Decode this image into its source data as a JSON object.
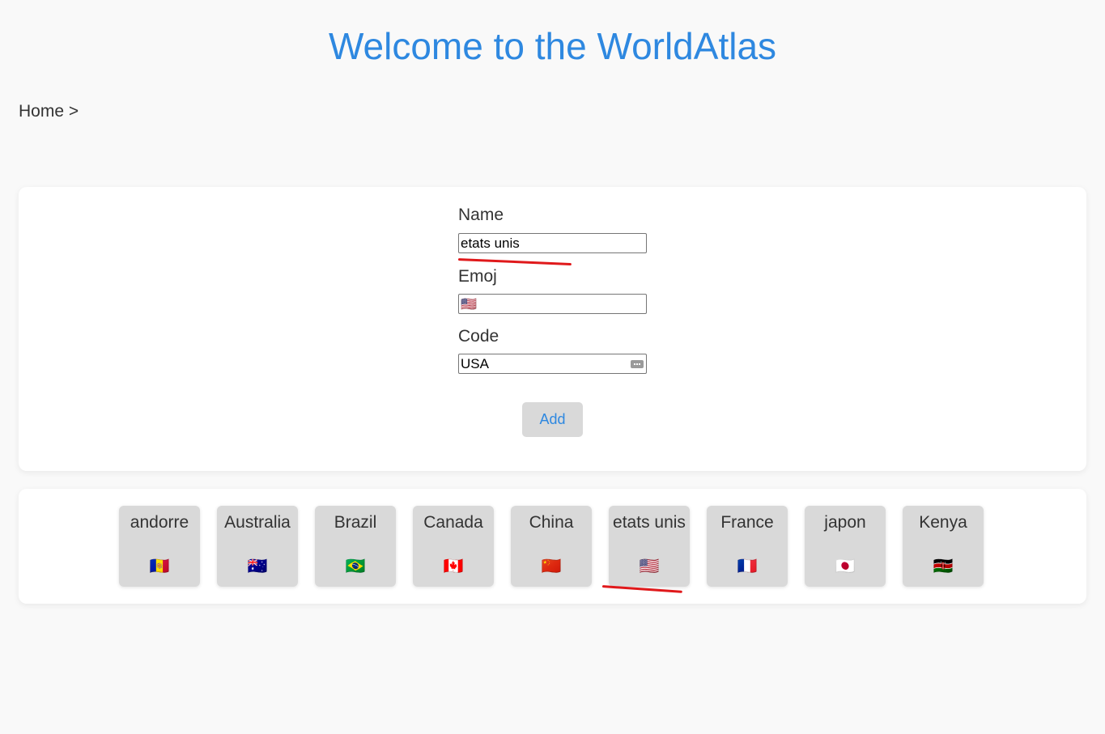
{
  "header": {
    "title": "Welcome to the WorldAtlas"
  },
  "breadcrumb": {
    "text": "Home >"
  },
  "form": {
    "name_label": "Name",
    "name_value": "etats unis",
    "emoji_label": "Emoj",
    "emoji_value": "🇺🇸",
    "code_label": "Code",
    "code_value": "USA",
    "add_label": "Add"
  },
  "countries": [
    {
      "name": "andorre",
      "flag": "🇦🇩"
    },
    {
      "name": "Australia",
      "flag": "🇦🇺"
    },
    {
      "name": "Brazil",
      "flag": "🇧🇷"
    },
    {
      "name": "Canada",
      "flag": "🇨🇦"
    },
    {
      "name": "China",
      "flag": "🇨🇳"
    },
    {
      "name": "etats unis",
      "flag": "🇺🇸"
    },
    {
      "name": "France",
      "flag": "🇫🇷"
    },
    {
      "name": "japon",
      "flag": "🇯🇵"
    },
    {
      "name": "Kenya",
      "flag": "🇰🇪"
    }
  ],
  "colors": {
    "accent": "#2e88e0",
    "background": "#f9f9f9",
    "tile": "#d9d9d9",
    "spellcheck": "#e0191b"
  }
}
